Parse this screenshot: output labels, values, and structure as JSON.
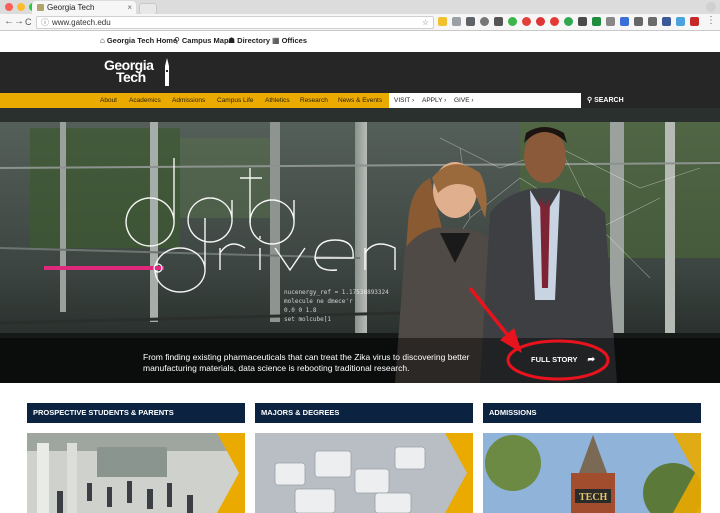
{
  "browser": {
    "tab_title": "Georgia Tech",
    "tab_close": "×",
    "url": "www.gatech.edu",
    "back": "←",
    "forward": "→",
    "reload": "C",
    "info": "ⓘ",
    "star": "☆",
    "menu": "⋮"
  },
  "utility": {
    "items": [
      {
        "icon": "⌂",
        "label": "Georgia Tech Home"
      },
      {
        "icon": "⚲",
        "label": "Campus Map"
      },
      {
        "icon": "☗",
        "label": "Directory"
      },
      {
        "icon": "▦",
        "label": "Offices"
      }
    ]
  },
  "header": {
    "logo_line1": "Georgia",
    "logo_line2": "Tech"
  },
  "mainnav": {
    "items": [
      "About",
      "Academics",
      "Admissions",
      "Campus Life",
      "Athletics",
      "Research",
      "News & Events"
    ],
    "actions": [
      "VISIT ›",
      "APPLY ›",
      "GIVE ›"
    ],
    "search": "SEARCH",
    "search_icon": "⚲"
  },
  "hero": {
    "word1": "data",
    "word2": "driven",
    "caption": "From finding existing pharmaceuticals that can treat the Zika virus to discovering better manufacturing materials, data science is rebooting traditional research.",
    "cta": "FULL STORY",
    "cta_icon": "➦",
    "code_lines": [
      "nucenergy_ref = 1.17538893324",
      "molecule ne dmece'r",
      "0.0 0 1.8",
      "set molcube[1"
    ]
  },
  "cards": [
    {
      "title": "PROSPECTIVE STUDENTS & PARENTS"
    },
    {
      "title": "MAJORS & DEGREES"
    },
    {
      "title": "ADMISSIONS"
    }
  ],
  "colors": {
    "gold": "#EAAA00",
    "navy": "#0B2240",
    "dark": "#262626",
    "magenta": "#E0287D",
    "annotation_red": "#E8131D"
  }
}
